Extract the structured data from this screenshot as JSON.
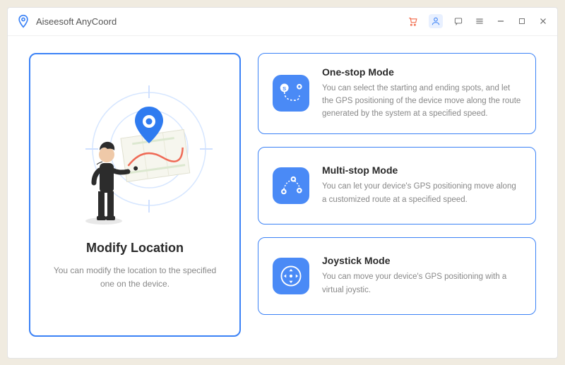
{
  "app": {
    "title": "Aiseesoft AnyCoord"
  },
  "main_card": {
    "title": "Modify Location",
    "description": "You can modify the location to the specified one on the device."
  },
  "modes": [
    {
      "title": "One-stop Mode",
      "description": "You can select the starting and ending spots, and let the GPS positioning of the device move along the route generated by the system at a specified speed."
    },
    {
      "title": "Multi-stop Mode",
      "description": "You can let your device's GPS positioning move along a customized route at a specified speed."
    },
    {
      "title": "Joystick Mode",
      "description": "You can move your device's GPS positioning with a virtual joystic."
    }
  ],
  "colors": {
    "accent": "#3b82f6",
    "icon_bg": "#4a8af6"
  }
}
